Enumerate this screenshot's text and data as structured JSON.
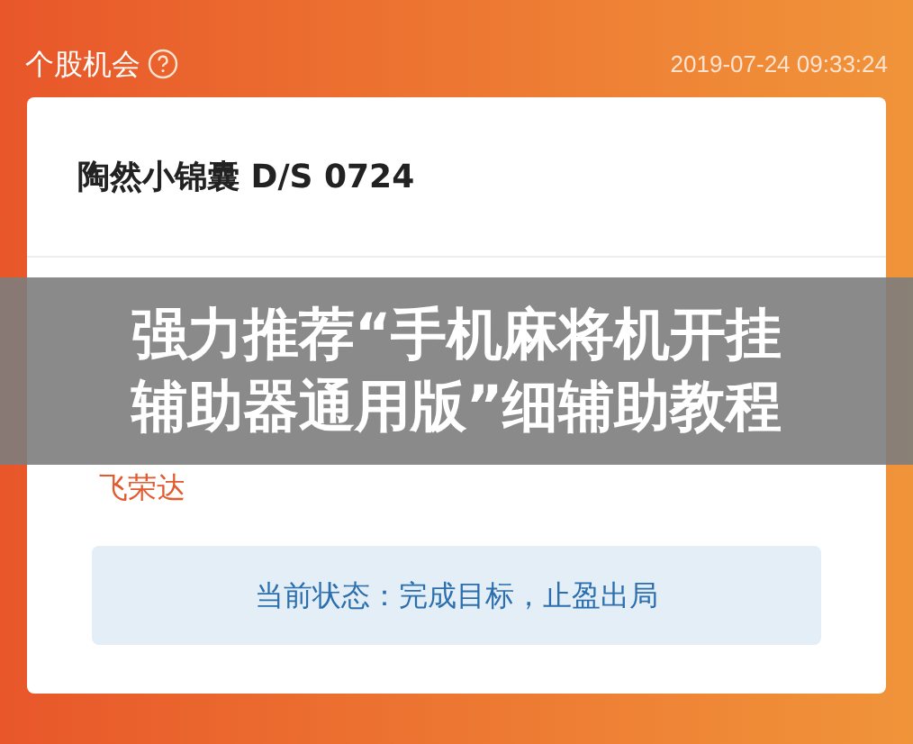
{
  "header": {
    "title": "个股机会",
    "timestamp": "2019-07-24 09:33:24"
  },
  "card": {
    "title": "陶然小锦囊 D/S 0724",
    "stock_name": "飞荣达",
    "status": "当前状态：完成目标，止盈出局"
  },
  "overlay": {
    "lines": [
      "强力推荐“手机麻将机开挂",
      "辅助器通用版”细辅助教程"
    ]
  }
}
